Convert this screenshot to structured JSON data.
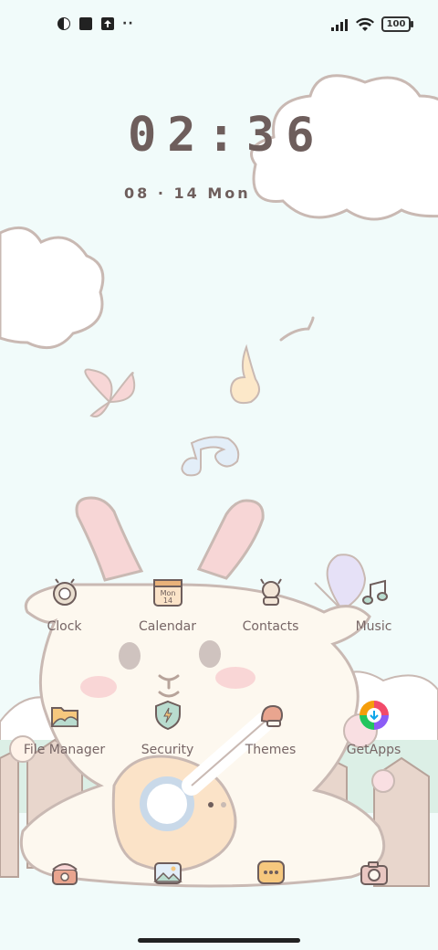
{
  "status_bar": {
    "left_icons": [
      "pie-icon",
      "square-icon",
      "upload-icon"
    ],
    "more_dots": "··",
    "battery": "100"
  },
  "lockscreen": {
    "time": "02:36",
    "date": "08 · 14 Mon"
  },
  "apps": {
    "row1": [
      {
        "label": "Clock",
        "icon": "clock-icon"
      },
      {
        "label": "Calendar",
        "icon": "calendar-icon",
        "icon_text_top": "Mon",
        "icon_text_bottom": "14"
      },
      {
        "label": "Contacts",
        "icon": "contacts-icon"
      },
      {
        "label": "Music",
        "icon": "music-icon"
      }
    ],
    "row2": [
      {
        "label": "File Manager",
        "icon": "folder-icon"
      },
      {
        "label": "Security",
        "icon": "shield-icon"
      },
      {
        "label": "Themes",
        "icon": "themes-icon"
      },
      {
        "label": "GetApps",
        "icon": "getapps-icon"
      }
    ],
    "dock": [
      {
        "icon": "phone-icon"
      },
      {
        "icon": "gallery-icon"
      },
      {
        "icon": "messages-icon"
      },
      {
        "icon": "camera-icon"
      }
    ]
  },
  "pager": {
    "pages": 2,
    "current": 1
  },
  "colors": {
    "background": "#f1fbfa",
    "ink": "#6e5e5c",
    "cream": "#fdf8ef",
    "pink": "#f7d6d6"
  }
}
